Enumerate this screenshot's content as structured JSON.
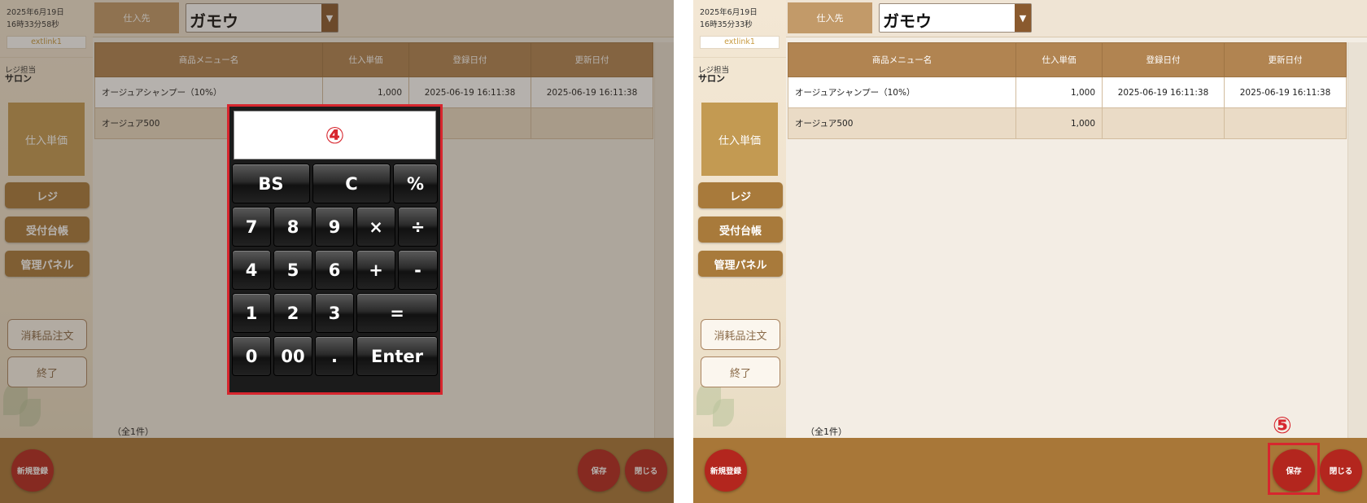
{
  "panels": [
    {
      "sidebar": {
        "date": "2025年6月19日",
        "time": "16時33分58秒",
        "link": "extlink1",
        "staff_label": "レジ担当",
        "staff_name": "サロン",
        "current": "仕入単価",
        "nav": [
          "レジ",
          "受付台帳",
          "管理パネル"
        ],
        "outline": [
          "消耗品注文",
          "終了"
        ]
      },
      "header": {
        "label": "仕入先",
        "supplier": "ガモウ"
      },
      "table": {
        "columns": [
          "商品メニュー名",
          "仕入単価",
          "登録日付",
          "更新日付"
        ],
        "rows": [
          [
            "オージュアシャンプー（10%）",
            "1,000",
            "2025-06-19 16:11:38",
            "2025-06-19 16:11:38"
          ],
          [
            "オージュア500",
            "",
            "",
            ""
          ]
        ],
        "count": "（全1件）"
      },
      "footer": {
        "new": "新規登録",
        "save": "保存",
        "close": "閉じる"
      }
    },
    {
      "sidebar": {
        "date": "2025年6月19日",
        "time": "16時35分33秒",
        "link": "extlink1",
        "staff_label": "レジ担当",
        "staff_name": "サロン",
        "current": "仕入単価",
        "nav": [
          "レジ",
          "受付台帳",
          "管理パネル"
        ],
        "outline": [
          "消耗品注文",
          "終了"
        ]
      },
      "header": {
        "label": "仕入先",
        "supplier": "ガモウ"
      },
      "table": {
        "columns": [
          "商品メニュー名",
          "仕入単価",
          "登録日付",
          "更新日付"
        ],
        "rows": [
          [
            "オージュアシャンプー（10%）",
            "1,000",
            "2025-06-19 16:11:38",
            "2025-06-19 16:11:38"
          ],
          [
            "オージュア500",
            "1,000",
            "",
            ""
          ]
        ],
        "count": "（全1件）"
      },
      "footer": {
        "new": "新規登録",
        "save": "保存",
        "close": "閉じる"
      }
    }
  ],
  "calculator": {
    "step": "④",
    "keys": {
      "bs": "BS",
      "c": "C",
      "pct": "%",
      "k7": "7",
      "k8": "8",
      "k9": "9",
      "mul": "×",
      "div": "÷",
      "k4": "4",
      "k5": "5",
      "k6": "6",
      "add": "+",
      "sub": "-",
      "k1": "1",
      "k2": "2",
      "k3": "3",
      "eq": "=",
      "k0": "0",
      "k00": "00",
      "dot": ".",
      "enter": "Enter"
    }
  },
  "annotation": {
    "step": "⑤"
  },
  "colors": {
    "brown": "#a87738",
    "red": "#b3261e",
    "highlight": "#d7262e"
  }
}
